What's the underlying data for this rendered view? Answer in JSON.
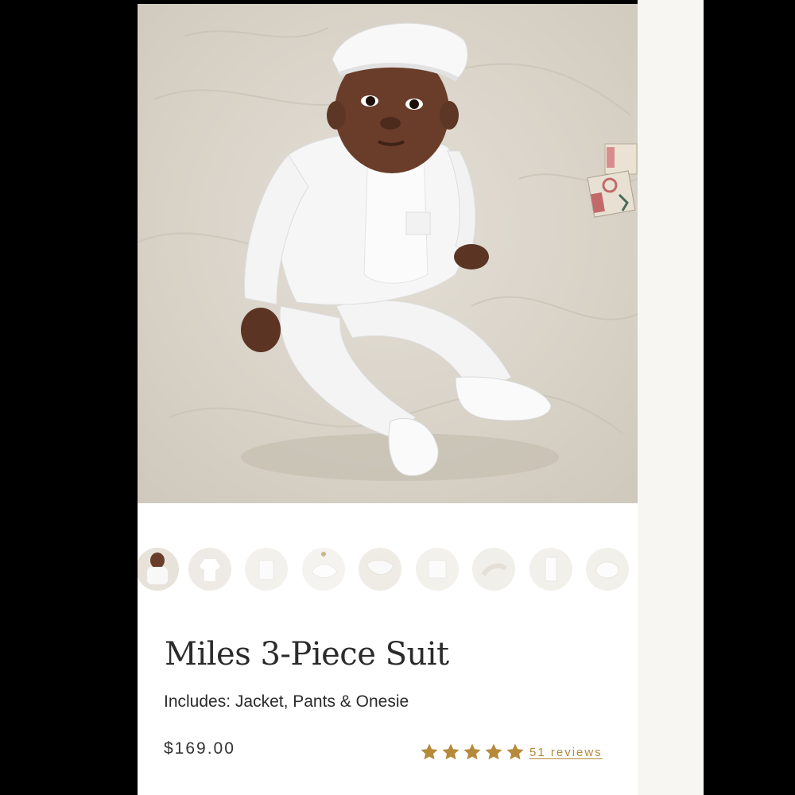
{
  "product": {
    "title": "Miles 3-Piece Suit",
    "includes": "Includes: Jacket, Pants & Onesie",
    "price": "$169.00",
    "rating": {
      "stars": 5,
      "max": 5,
      "reviews_label": "51 reviews"
    }
  },
  "gallery": {
    "hero_alt": "baby-in-white-suit-photo",
    "thumbnail_count": 9,
    "active_thumbnail": 1
  },
  "colors": {
    "star": "#b58a3b",
    "reviews_link": "#b58a3b",
    "text": "#2b2b2b",
    "background": "#ffffff",
    "frame": "#000000"
  }
}
